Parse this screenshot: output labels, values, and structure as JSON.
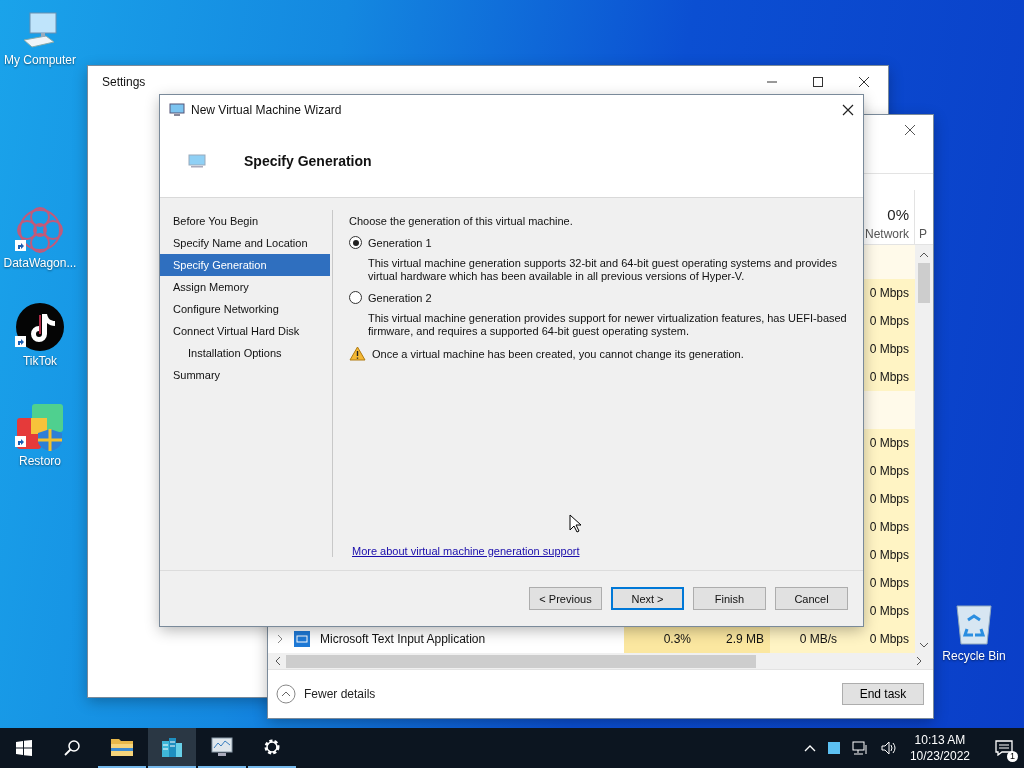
{
  "desktop_icons": [
    {
      "kind": "computer",
      "label": "My Computer",
      "shortcut": false
    },
    {
      "kind": "mandala",
      "label": "DataWagon...",
      "shortcut": true
    },
    {
      "kind": "note",
      "label": "TikTok",
      "shortcut": true
    },
    {
      "kind": "tiles",
      "label": "Restoro",
      "shortcut": true
    },
    {
      "kind": "bin",
      "label": "Recycle Bin",
      "shortcut": false
    }
  ],
  "settings_window": {
    "title": "Settings"
  },
  "task_manager": {
    "network_header": {
      "percent": "0%",
      "label": "Network"
    },
    "cut_column": "P",
    "rows": [
      {
        "kind": "group"
      },
      {
        "kind": "process",
        "network": "0 Mbps"
      },
      {
        "kind": "process",
        "network": "0 Mbps"
      },
      {
        "kind": "process",
        "network": "0 Mbps"
      },
      {
        "kind": "process",
        "network": "0 Mbps"
      },
      {
        "kind": "group"
      },
      {
        "kind": "process",
        "network": "0 Mbps"
      },
      {
        "kind": "process",
        "network": "0 Mbps"
      },
      {
        "kind": "process",
        "network": "0 Mbps"
      },
      {
        "kind": "process",
        "network": "0 Mbps"
      },
      {
        "kind": "process",
        "network": "0 Mbps"
      },
      {
        "kind": "process",
        "network": "0 Mbps"
      },
      {
        "kind": "process",
        "network": "0 Mbps"
      },
      {
        "kind": "process",
        "name": "Microsoft Text Input Application",
        "cpu": "0.3%",
        "memory": "2.9 MB",
        "disk": "0 MB/s",
        "network": "0 Mbps"
      }
    ],
    "fewer_details": "Fewer details",
    "end_task": "End task"
  },
  "wizard": {
    "title": "New Virtual Machine Wizard",
    "heading": "Specify Generation",
    "nav": [
      {
        "label": "Before You Begin",
        "selected": false
      },
      {
        "label": "Specify Name and Location",
        "selected": false
      },
      {
        "label": "Specify Generation",
        "selected": true
      },
      {
        "label": "Assign Memory",
        "selected": false
      },
      {
        "label": "Configure Networking",
        "selected": false
      },
      {
        "label": "Connect Virtual Hard Disk",
        "selected": false,
        "children": [
          {
            "label": "Installation Options",
            "selected": false
          }
        ]
      },
      {
        "label": "Summary",
        "selected": false
      }
    ],
    "intro": "Choose the generation of this virtual machine.",
    "options": [
      {
        "label": "Generation 1",
        "selected": true,
        "description": "This virtual machine generation supports 32-bit and 64-bit guest operating systems and provides virtual hardware which has been available in all previous versions of Hyper-V."
      },
      {
        "label": "Generation 2",
        "selected": false,
        "description": "This virtual machine generation provides support for newer virtualization features, has UEFI-based firmware, and requires a supported 64-bit guest operating system."
      }
    ],
    "warning": "Once a virtual machine has been created, you cannot change its generation.",
    "link": "More about virtual machine generation support",
    "buttons": [
      {
        "label": "< Previous",
        "default": false
      },
      {
        "label": "Next >",
        "default": true
      },
      {
        "label": "Finish",
        "default": false
      },
      {
        "label": "Cancel",
        "default": false
      }
    ]
  },
  "taskbar": {
    "apps": [
      {
        "kind": "folder",
        "running": true,
        "selected": false
      },
      {
        "kind": "servers",
        "running": true,
        "selected": true
      },
      {
        "kind": "monitor",
        "running": true,
        "selected": false
      },
      {
        "kind": "gear",
        "running": true,
        "selected": false
      }
    ],
    "time": "10:13 AM",
    "date": "10/23/2022",
    "notifications": "1"
  }
}
